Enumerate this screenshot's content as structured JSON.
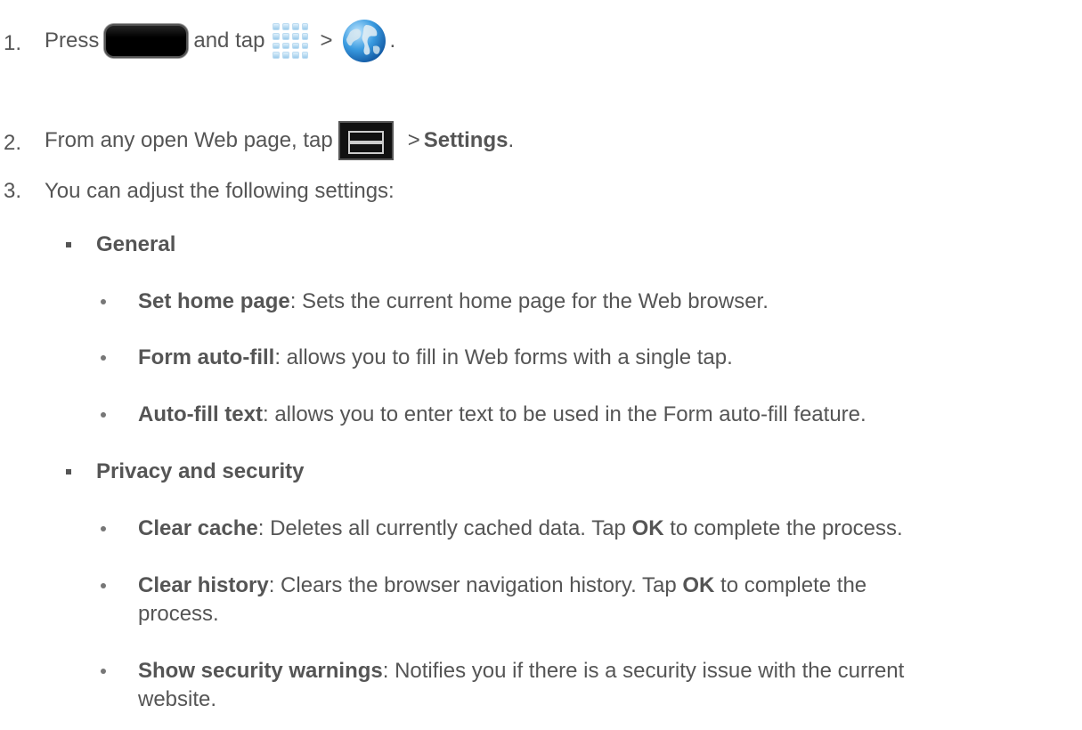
{
  "steps": [
    {
      "num": "1.",
      "press": "Press",
      "and_tap": "and tap",
      "gt": ">",
      "end": ".",
      "icons": [
        "home-key-icon",
        "apps-grid-icon",
        "browser-globe-icon"
      ]
    },
    {
      "num": "2.",
      "prefix": "From any open Web page, tap",
      "gt": ">",
      "settings": "Settings",
      "end": ".",
      "icons": [
        "menu-key-icon"
      ]
    },
    {
      "num": "3.",
      "text": "You can adjust the following settings:"
    }
  ],
  "sections": [
    {
      "title": "General",
      "items": [
        {
          "term": "Set home page",
          "desc": ": Sets the current home page for the Web browser."
        },
        {
          "term": "Form auto-fill",
          "desc": ": allows you to fill in Web forms with a single tap."
        },
        {
          "term": "Auto-fill text",
          "desc": ": allows you to enter text to be used in the Form auto-fill feature."
        }
      ]
    },
    {
      "title": "Privacy and security",
      "items": [
        {
          "term": "Clear cache",
          "desc": ": Deletes all currently cached data. Tap ",
          "ok": "OK",
          "after": " to complete the process."
        },
        {
          "term": "Clear history",
          "desc": ": Clears the browser navigation history. Tap ",
          "ok": "OK",
          "after": " to complete the",
          "line2": "process."
        },
        {
          "term": "Show security warnings",
          "desc": ": Notifies you if there is a security issue with the current",
          "line2": "website."
        }
      ]
    }
  ]
}
